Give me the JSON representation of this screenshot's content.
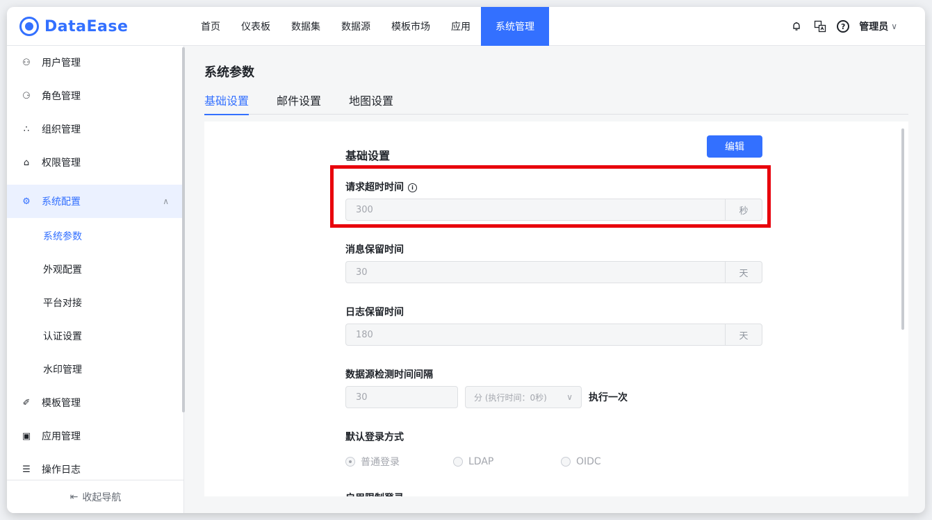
{
  "header": {
    "logo_text": "DataEase",
    "nav": [
      "首页",
      "仪表板",
      "数据集",
      "数据源",
      "模板市场",
      "应用",
      "系统管理"
    ],
    "active_nav": "系统管理",
    "user": "管理员"
  },
  "sidebar": {
    "items": [
      {
        "label": "用户管理",
        "icon": "users-icon"
      },
      {
        "label": "角色管理",
        "icon": "role-icon"
      },
      {
        "label": "组织管理",
        "icon": "org-icon"
      },
      {
        "label": "权限管理",
        "icon": "lock-icon"
      },
      {
        "label": "系统配置",
        "icon": "settings-icon"
      }
    ],
    "sub_items": [
      "系统参数",
      "外观配置",
      "平台对接",
      "认证设置",
      "水印管理"
    ],
    "bottom_items": [
      {
        "label": "模板管理",
        "icon": "template-icon"
      },
      {
        "label": "应用管理",
        "icon": "app-icon"
      },
      {
        "label": "操作日志",
        "icon": "log-icon"
      }
    ],
    "footer": "收起导航"
  },
  "main": {
    "title": "系统参数",
    "tabs": [
      "基础设置",
      "邮件设置",
      "地图设置"
    ],
    "active_tab": "基础设置",
    "section_title": "基础设置",
    "edit_button": "编辑",
    "fields": {
      "request_timeout": {
        "label": "请求超时时间",
        "value": "300",
        "unit": "秒"
      },
      "message_retention": {
        "label": "消息保留时间",
        "value": "30",
        "unit": "天"
      },
      "log_retention": {
        "label": "日志保留时间",
        "value": "180",
        "unit": "天"
      },
      "ds_check": {
        "label": "数据源检测时间间隔",
        "value": "30",
        "select": "分 (执行时间：0秒)",
        "after": "执行一次"
      },
      "login_method": {
        "label": "默认登录方式",
        "options": [
          "普通登录",
          "LDAP",
          "OIDC"
        ],
        "selected": "普通登录"
      },
      "limit_login": {
        "label": "启用限制登录"
      }
    }
  }
}
